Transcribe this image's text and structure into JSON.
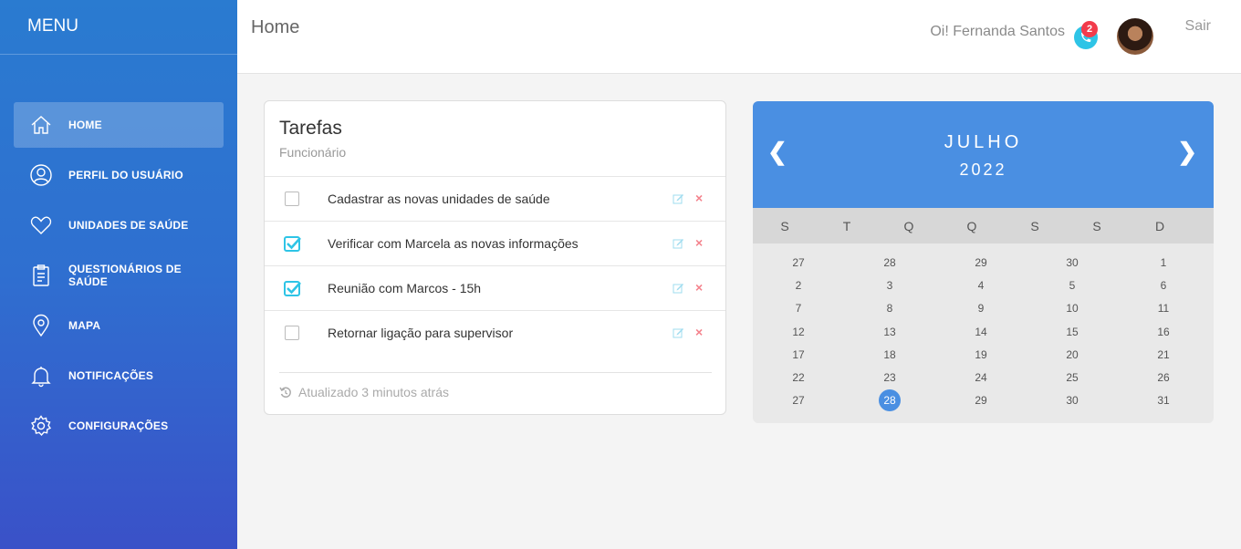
{
  "sidebar": {
    "title": "MENU",
    "items": [
      {
        "label": "HOME",
        "icon": "home-icon"
      },
      {
        "label": "PERFIL DO USUÁRIO",
        "icon": "user-icon"
      },
      {
        "label": "UNIDADES DE SAÚDE",
        "icon": "heart-icon"
      },
      {
        "label": "QUESTIONÁRIOS DE SAÚDE",
        "icon": "clipboard-icon"
      },
      {
        "label": "MAPA",
        "icon": "map-pin-icon"
      },
      {
        "label": "NOTIFICAÇÕES",
        "icon": "bell-icon"
      },
      {
        "label": "CONFIGURAÇÕES",
        "icon": "gear-icon"
      }
    ],
    "active": "HOME"
  },
  "header": {
    "title": "Home",
    "greeting": "Oi! Fernanda Santos",
    "notification_count": "2",
    "logout": "Sair"
  },
  "tasks": {
    "title": "Tarefas",
    "subtitle": "Funcionário",
    "items": [
      {
        "text": "Cadastrar as novas unidades de saúde",
        "checked": false
      },
      {
        "text": "Verificar com Marcela as novas informações",
        "checked": true
      },
      {
        "text": "Reunião com Marcos - 15h",
        "checked": true
      },
      {
        "text": "Retornar ligação para supervisor",
        "checked": false
      }
    ],
    "footer": "Atualizado 3 minutos atrás"
  },
  "calendar": {
    "month": "JULHO",
    "year": "2022",
    "prev": "❮",
    "next": "❯",
    "weekdays": [
      "S",
      "T",
      "Q",
      "Q",
      "S",
      "S",
      "D"
    ],
    "weeks": [
      [
        "27",
        "28",
        "29",
        "30",
        "1"
      ],
      [
        "2",
        "3",
        "4",
        "5",
        "6"
      ],
      [
        "7",
        "8",
        "9",
        "10",
        "11"
      ],
      [
        "12",
        "13",
        "14",
        "15",
        "16"
      ],
      [
        "17",
        "18",
        "19",
        "20",
        "21"
      ],
      [
        "22",
        "23",
        "24",
        "25",
        "26"
      ],
      [
        "27",
        "28",
        "29",
        "30",
        "31"
      ]
    ],
    "selected": "28"
  },
  "colors": {
    "accent": "#4a8fe2",
    "check": "#2ec4e6",
    "delete": "#f4828c",
    "badge": "#f23b4b"
  }
}
